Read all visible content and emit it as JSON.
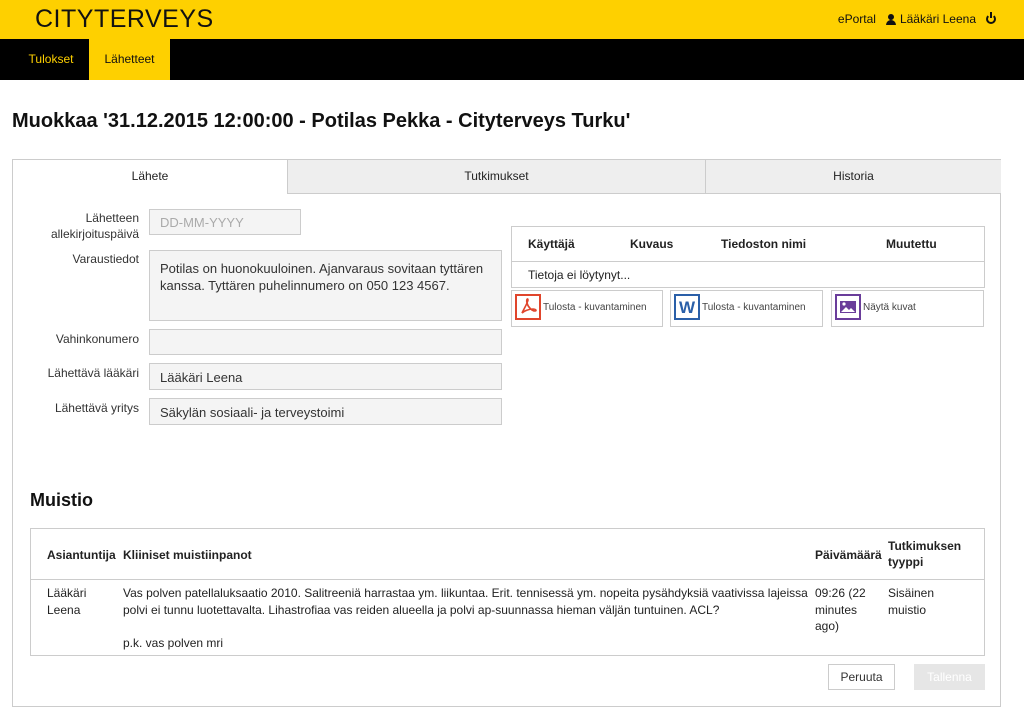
{
  "header": {
    "logo": "CITYTERVEYS",
    "eportal": "ePortal",
    "user": "Lääkäri Leena"
  },
  "nav": {
    "tabs": [
      {
        "label": "Tulokset"
      },
      {
        "label": "Lähetteet"
      }
    ]
  },
  "page_title": "Muokkaa '31.12.2015 12:00:00 - Potilas Pekka - Cityterveys Turku'",
  "tabs": [
    {
      "label": "Lähete"
    },
    {
      "label": "Tutkimukset"
    },
    {
      "label": "Historia"
    }
  ],
  "form": {
    "signature_date_label_1": "Lähetteen",
    "signature_date_label_2": "allekirjoituspäivä",
    "signature_date_placeholder": "DD-MM-YYYY",
    "booking_label": "Varaustiedot",
    "booking_value_1": "Potilas on huonokuuloinen. Ajanvaraus sovitaan tyttären",
    "booking_value_2": "kanssa. Tyttären puhelinnumero on 050 123 4567.",
    "damage_label": "Vahinkonumero",
    "damage_value": "",
    "doctor_label": "Lähettävä lääkäri",
    "doctor_value": "Lääkäri Leena",
    "company_label": "Lähettävä yritys",
    "company_value": "Säkylän sosiaali- ja terveystoimi"
  },
  "files": {
    "columns": [
      "Käyttäjä",
      "Kuvaus",
      "Tiedoston nimi",
      "Muutettu"
    ],
    "empty_text": "Tietoja ei löytynyt...",
    "buttons": [
      {
        "label": "Tulosta - kuvantaminen",
        "icon": "pdf-icon",
        "color": "#e0452c"
      },
      {
        "label": "Tulosta - kuvantaminen",
        "icon": "word-icon",
        "color": "#2a5fa8"
      },
      {
        "label": "Näytä kuvat",
        "icon": "image-icon",
        "color": "#6a3d9a"
      }
    ]
  },
  "notes": {
    "title": "Muistio",
    "columns": {
      "expert": "Asiantuntija",
      "clinical": "Kliiniset muistiinpanot",
      "date": "Päivämäärä",
      "type_1": "Tutkimuksen",
      "type_2": "tyyppi"
    },
    "row": {
      "expert_1": "Lääkäri",
      "expert_2": "Leena",
      "clinical_1": "Vas polven patellaluksaatio 2010. Salitreeniä harrastaa ym. liikuntaa. Erit. tennisessä ym. nopeita pysähdyksiä vaativissa lajeissa",
      "clinical_2": "polvi ei tunnu luotettavalta. Lihastrofiaa vas reiden alueella ja polvi ap-suunnassa hieman väljän tuntuinen. ACL?",
      "clinical_3": "p.k. vas polven mri",
      "date_1": "09:26 (22",
      "date_2": "minutes",
      "date_3": "ago)",
      "type_1": "Sisäinen",
      "type_2": "muistio"
    }
  },
  "actions": {
    "cancel": "Peruuta",
    "save": "Tallenna"
  },
  "colors": {
    "brand_yellow": "#fed000",
    "nav_black": "#000000"
  }
}
